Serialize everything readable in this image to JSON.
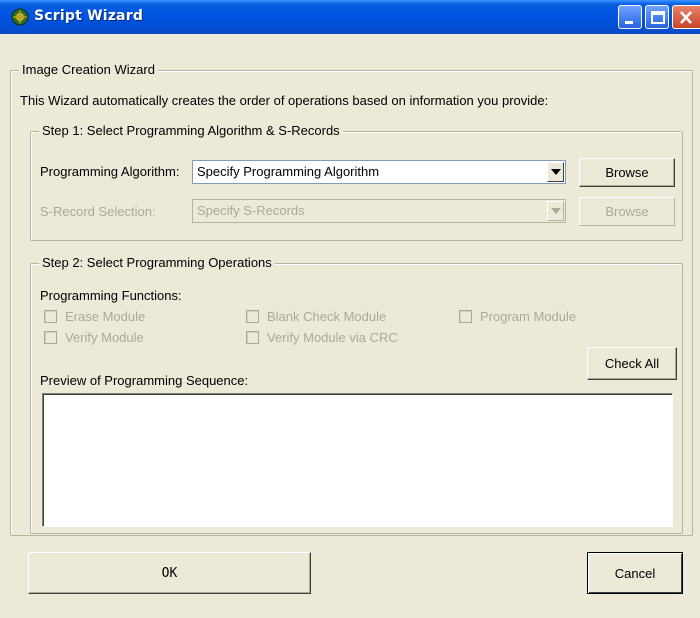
{
  "window": {
    "title": "Script Wizard"
  },
  "wizard": {
    "group_title": "Image Creation Wizard",
    "intro": "This Wizard automatically creates the order of operations based on information you provide:"
  },
  "step1": {
    "title": "Step 1:  Select Programming Algorithm & S-Records",
    "algorithm_label": "Programming Algorithm:",
    "algorithm_value": "Specify Programming Algorithm",
    "algorithm_browse": "Browse",
    "srecord_label": "S-Record Selection:",
    "srecord_value": "Specify S-Records",
    "srecord_browse": "Browse"
  },
  "step2": {
    "title": "Step 2:  Select Programming Operations",
    "functions_label": "Programming Functions:",
    "checkboxes": [
      {
        "label": "Erase Module"
      },
      {
        "label": "Blank Check Module"
      },
      {
        "label": "Program Module"
      },
      {
        "label": "Verify Module"
      },
      {
        "label": "Verify Module via CRC"
      }
    ],
    "check_all": "Check All",
    "preview_label": "Preview of Programming Sequence:"
  },
  "buttons": {
    "ok": "OK",
    "cancel": "Cancel"
  }
}
